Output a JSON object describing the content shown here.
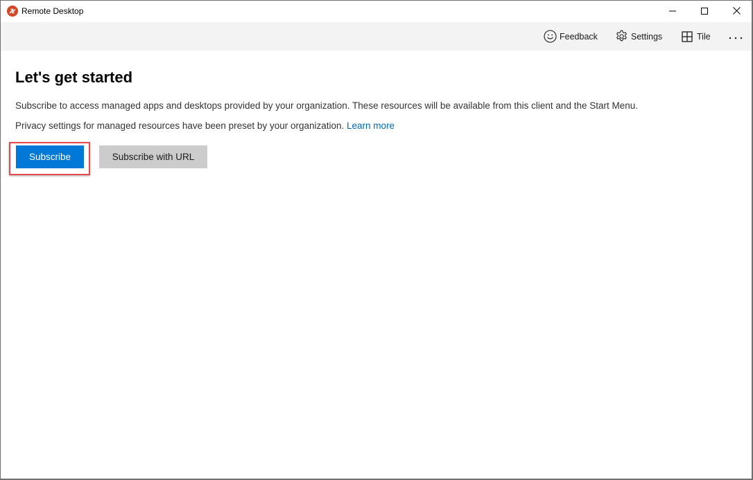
{
  "window": {
    "title": "Remote Desktop",
    "app_icon": "remote-desktop-icon",
    "controls": {
      "minimize": "minimize-icon",
      "maximize": "maximize-icon",
      "close": "close-icon"
    }
  },
  "toolbar": {
    "items": [
      {
        "label": "Feedback",
        "icon": "smiley-icon"
      },
      {
        "label": "Settings",
        "icon": "gear-icon"
      },
      {
        "label": "Tile",
        "icon": "grid-icon"
      },
      {
        "label": "",
        "icon": "more-icon"
      }
    ]
  },
  "main": {
    "heading": "Let's get started",
    "description": "Subscribe to access managed apps and desktops provided by your organization. These resources will be available from this client and the Start Menu.",
    "privacy_text": "Privacy settings for managed resources have been preset by your organization.",
    "learn_more_label": "Learn more",
    "subscribe_label": "Subscribe",
    "subscribe_url_label": "Subscribe with URL"
  },
  "colors": {
    "accent": "#0078d7",
    "link": "#0067b8",
    "focus_highlight": "#e8484f",
    "app_icon": "#d24726",
    "toolbar_bg": "#f3f3f3",
    "secondary_button": "#cccccc"
  }
}
